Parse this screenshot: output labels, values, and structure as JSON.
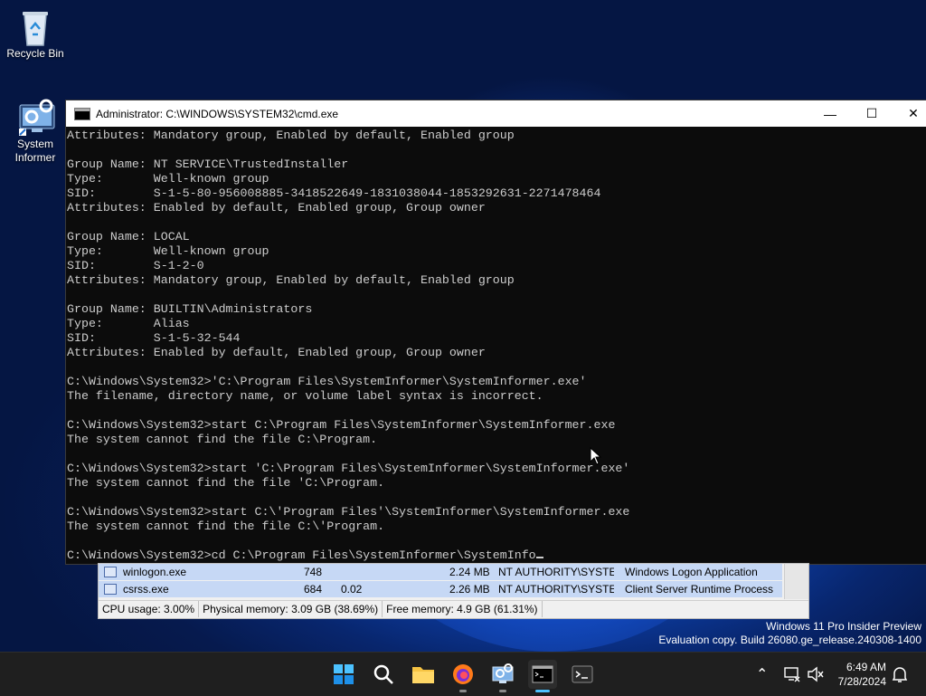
{
  "desktop": {
    "icons": [
      {
        "label": "Recycle Bin"
      },
      {
        "label": "System\nInformer"
      }
    ],
    "watermark_line1": "Windows 11 Pro Insider Preview",
    "watermark_line2": "Evaluation copy. Build 26080.ge_release.240308-1400"
  },
  "window": {
    "title": "Administrator: C:\\WINDOWS\\SYSTEM32\\cmd.exe",
    "minimize_glyph": "—",
    "maximize_glyph": "☐",
    "close_glyph": "✕",
    "console_lines": [
      "Attributes: Mandatory group, Enabled by default, Enabled group",
      "",
      "Group Name: NT SERVICE\\TrustedInstaller",
      "Type:       Well-known group",
      "SID:        S-1-5-80-956008885-3418522649-1831038044-1853292631-2271478464",
      "Attributes: Enabled by default, Enabled group, Group owner",
      "",
      "Group Name: LOCAL",
      "Type:       Well-known group",
      "SID:        S-1-2-0",
      "Attributes: Mandatory group, Enabled by default, Enabled group",
      "",
      "Group Name: BUILTIN\\Administrators",
      "Type:       Alias",
      "SID:        S-1-5-32-544",
      "Attributes: Enabled by default, Enabled group, Group owner",
      "",
      "C:\\Windows\\System32>'C:\\Program Files\\SystemInformer\\SystemInformer.exe'",
      "The filename, directory name, or volume label syntax is incorrect.",
      "",
      "C:\\Windows\\System32>start C:\\Program Files\\SystemInformer\\SystemInformer.exe",
      "The system cannot find the file C:\\Program.",
      "",
      "C:\\Windows\\System32>start 'C:\\Program Files\\SystemInformer\\SystemInformer.exe'",
      "The system cannot find the file 'C:\\Program.",
      "",
      "C:\\Windows\\System32>start C:\\'Program Files'\\SystemInformer\\SystemInformer.exe",
      "The system cannot find the file C:\\'Program.",
      ""
    ],
    "prompt_input": "C:\\Windows\\System32>cd C:\\Program Files\\SystemInformer\\SystemInfo"
  },
  "sysinformer": {
    "rows": [
      {
        "name": "winlogon.exe",
        "pid": "748",
        "cpu": "",
        "private": "2.24 MB",
        "user": "NT AUTHORITY\\SYSTEM",
        "desc": "Windows Logon Application"
      },
      {
        "name": "csrss.exe",
        "pid": "684",
        "cpu": "0.02",
        "private": "2.26 MB",
        "user": "NT AUTHORITY\\SYSTEM",
        "desc": "Client Server Runtime Process"
      }
    ],
    "status": {
      "cpu": "CPU usage: 3.00%",
      "physical": "Physical memory: 3.09 GB (38.69%)",
      "free": "Free memory: 4.9 GB (61.31%)"
    }
  },
  "taskbar": {
    "icons": [
      "start-icon",
      "search-icon",
      "file-explorer-icon",
      "firefox-icon",
      "system-informer-icon",
      "cmd-icon",
      "terminal-icon"
    ],
    "time": "6:49 AM",
    "date": "7/28/2024"
  }
}
